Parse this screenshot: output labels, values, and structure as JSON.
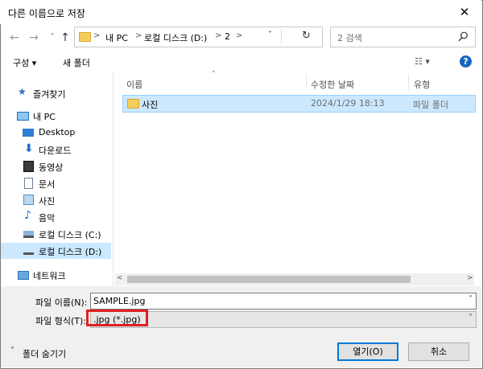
{
  "window": {
    "title": "다른 이름으로 저장"
  },
  "nav": {
    "back": "←",
    "forward": "→",
    "recent": "˅",
    "up": "↑",
    "breadcrumb": [
      "내 PC",
      "로컬 디스크 (D:)",
      "2"
    ],
    "refresh": "↻",
    "search_placeholder": "2 검색"
  },
  "toolbar": {
    "organize": "구성 ▾",
    "new_folder": "새 폴더",
    "view": "☷ ▾",
    "help": "?"
  },
  "sidebar": {
    "items": [
      {
        "label": "즐겨찾기",
        "icon": "star-icon"
      },
      {
        "label": "내 PC",
        "icon": "computer-icon"
      },
      {
        "label": "Desktop",
        "icon": "desktop-icon"
      },
      {
        "label": "다운로드",
        "icon": "download-icon"
      },
      {
        "label": "동영상",
        "icon": "video-icon"
      },
      {
        "label": "문서",
        "icon": "document-icon"
      },
      {
        "label": "사진",
        "icon": "picture-icon"
      },
      {
        "label": "음악",
        "icon": "music-icon"
      },
      {
        "label": "로컬 디스크 (C:)",
        "icon": "drive-icon"
      },
      {
        "label": "로컬 디스크 (D:)",
        "icon": "drive-icon"
      },
      {
        "label": "네트워크",
        "icon": "network-icon"
      }
    ]
  },
  "filelist": {
    "columns": [
      "이름",
      "수정한 날짜",
      "유형"
    ],
    "rows": [
      {
        "name": "사진",
        "date": "2024/1/29 18:13",
        "type": "파일 폴더"
      }
    ]
  },
  "form": {
    "filename_label": "파일 이름(N):",
    "filename_value": "SAMPLE.jpg",
    "filetype_label": "파일 형식(T):",
    "filetype_value": ".jpg (*.jpg)"
  },
  "footer": {
    "hide_folders": "폴더 숨기기",
    "open": "열기(O)",
    "cancel": "취소"
  }
}
